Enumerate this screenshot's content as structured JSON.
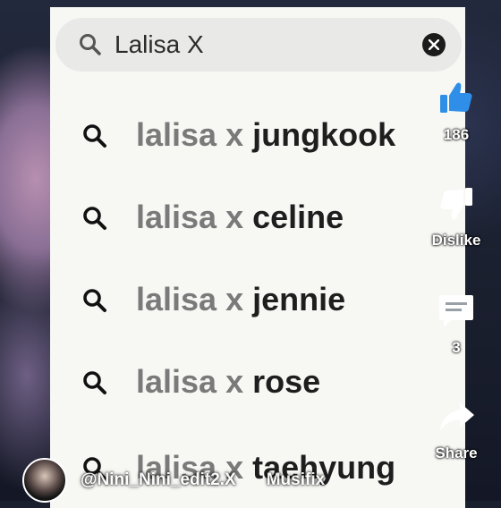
{
  "search": {
    "query": "Lalisa X",
    "icon": "search-icon",
    "clear_icon": "close-icon"
  },
  "suggestions": [
    {
      "prefix": "lalisa x ",
      "suffix": "jungkook"
    },
    {
      "prefix": "lalisa x ",
      "suffix": "celine"
    },
    {
      "prefix": "lalisa x ",
      "suffix": "jennie"
    },
    {
      "prefix": "lalisa x ",
      "suffix": "rose"
    },
    {
      "prefix": "lalisa x ",
      "suffix": "taehyung"
    }
  ],
  "side_actions": {
    "like": {
      "count": "186",
      "icon": "thumbs-up-icon",
      "color": "#2f8fe8"
    },
    "dislike": {
      "label": "Dislike",
      "icon": "thumbs-down-icon"
    },
    "comments": {
      "count": "3",
      "icon": "comment-icon"
    },
    "share": {
      "label": "Share",
      "icon": "share-icon"
    }
  },
  "footer": {
    "channel": "@Nini_Nini_edit2.X",
    "music": "Musifix"
  }
}
